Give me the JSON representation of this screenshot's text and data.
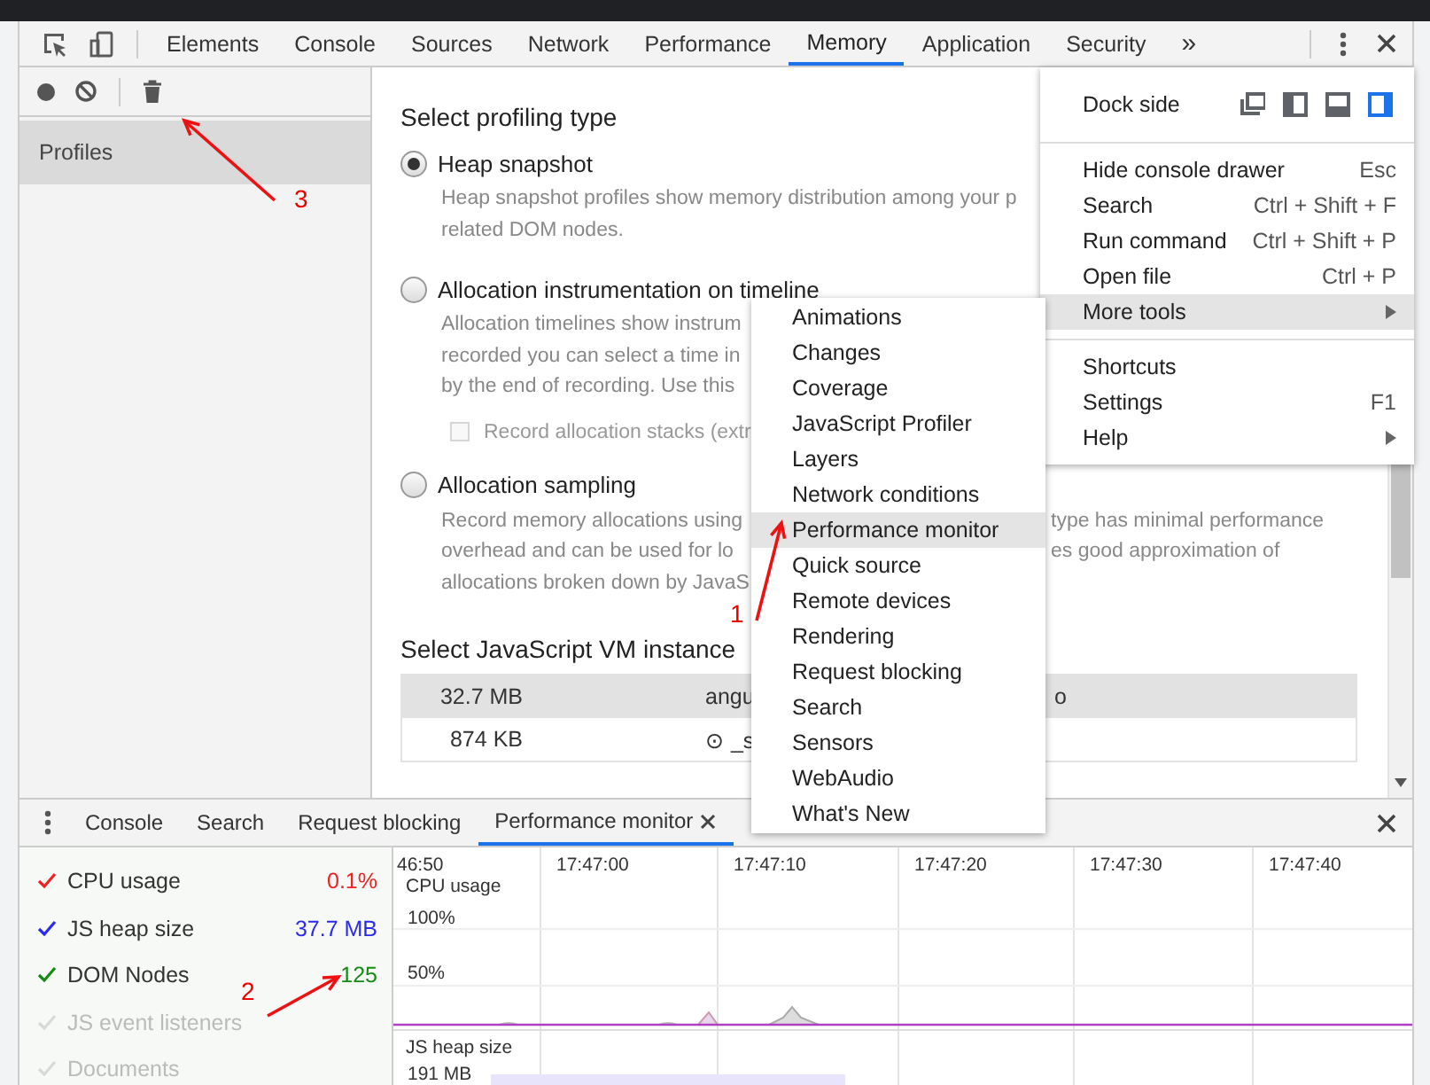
{
  "toolbar": {
    "tabs": [
      {
        "label": "Elements",
        "selected": false
      },
      {
        "label": "Console",
        "selected": false
      },
      {
        "label": "Sources",
        "selected": false
      },
      {
        "label": "Network",
        "selected": false
      },
      {
        "label": "Performance",
        "selected": false
      },
      {
        "label": "Memory",
        "selected": true
      },
      {
        "label": "Application",
        "selected": false
      },
      {
        "label": "Security",
        "selected": false
      }
    ],
    "overflow_label": "»"
  },
  "sidebar": {
    "items": [
      {
        "label": "Profiles",
        "selected": true
      }
    ]
  },
  "profiling": {
    "title": "Select profiling type",
    "options": [
      {
        "label": "Heap snapshot",
        "selected": true,
        "lines": [
          {
            "text": "Heap snapshot profiles show memory distribution among your p"
          },
          {
            "text": "related DOM nodes."
          }
        ]
      },
      {
        "label": "Allocation instrumentation on timeline",
        "selected": false,
        "lines": [
          {
            "text": "Allocation timelines show instrum"
          },
          {
            "text": "recorded you can select a time in"
          },
          {
            "text": "by the end of recording. Use this"
          }
        ],
        "checkbox": {
          "label": "Record allocation stacks (extr",
          "checked": false,
          "disabled": true
        }
      },
      {
        "label": "Allocation sampling",
        "selected": false,
        "lines": [
          {
            "text": "Record memory allocations using",
            "continuation": "type has minimal performance"
          },
          {
            "text": "overhead and can be used for lo",
            "continuation": "es good approximation of"
          },
          {
            "text": "allocations broken down by JavaS"
          }
        ]
      }
    ]
  },
  "vm_instance": {
    "title": "Select JavaScript VM instance",
    "rows": [
      {
        "size": "32.7 MB",
        "column_2": "angu",
        "column_3": "o",
        "selected": true
      },
      {
        "size": "874 KB",
        "column_2": "⊙ _s",
        "selected": false
      }
    ]
  },
  "main_menu": {
    "dock_side": {
      "label": "Dock side",
      "options": [
        {
          "kind": "undock",
          "selected": false
        },
        {
          "kind": "left",
          "selected": false
        },
        {
          "kind": "bottom",
          "selected": false
        },
        {
          "kind": "right",
          "selected": true
        }
      ]
    },
    "groups": [
      [
        {
          "label": "Hide console drawer",
          "shortcut": "Esc",
          "highlighted": false
        },
        {
          "label": "Search",
          "shortcut": "Ctrl + Shift + F",
          "highlighted": false
        },
        {
          "label": "Run command",
          "shortcut": "Ctrl + Shift + P",
          "highlighted": false
        },
        {
          "label": "Open file",
          "shortcut": "Ctrl + P",
          "highlighted": false
        },
        {
          "label": "More tools",
          "submenu": true,
          "highlighted": true
        }
      ],
      [
        {
          "label": "Shortcuts",
          "highlighted": false
        },
        {
          "label": "Settings",
          "shortcut": "F1",
          "highlighted": false
        },
        {
          "label": "Help",
          "submenu": true,
          "highlighted": false
        }
      ]
    ]
  },
  "submenu": {
    "items": [
      {
        "label": "Animations",
        "highlighted": false
      },
      {
        "label": "Changes",
        "highlighted": false
      },
      {
        "label": "Coverage",
        "highlighted": false
      },
      {
        "label": "JavaScript Profiler",
        "highlighted": false
      },
      {
        "label": "Layers",
        "highlighted": false
      },
      {
        "label": "Network conditions",
        "highlighted": false
      },
      {
        "label": "Performance monitor",
        "highlighted": true
      },
      {
        "label": "Quick source",
        "highlighted": false
      },
      {
        "label": "Remote devices",
        "highlighted": false
      },
      {
        "label": "Rendering",
        "highlighted": false
      },
      {
        "label": "Request blocking",
        "highlighted": false
      },
      {
        "label": "Search",
        "highlighted": false
      },
      {
        "label": "Sensors",
        "highlighted": false
      },
      {
        "label": "WebAudio",
        "highlighted": false
      },
      {
        "label": "What's New",
        "highlighted": false
      }
    ]
  },
  "drawer": {
    "tabs": [
      {
        "label": "Console",
        "selected": false
      },
      {
        "label": "Search",
        "selected": false
      },
      {
        "label": "Request blocking",
        "selected": false
      },
      {
        "label": "Performance monitor",
        "selected": true,
        "closable": true
      }
    ]
  },
  "performance_monitor": {
    "metrics": [
      {
        "label": "CPU usage",
        "value": "0.1%",
        "checked": true,
        "color": "#ee2222"
      },
      {
        "label": "JS heap size",
        "value": "37.7 MB",
        "checked": true,
        "color": "#2a2aee"
      },
      {
        "label": "DOM Nodes",
        "value": "125",
        "checked": true,
        "color": "#158a15"
      },
      {
        "label": "JS event listeners",
        "checked": false
      },
      {
        "label": "Documents",
        "checked": false
      }
    ],
    "time_labels": [
      "46:50",
      "17:47:00",
      "17:47:10",
      "17:47:20",
      "17:47:30",
      "17:47:40"
    ],
    "panels": [
      {
        "title": "CPU usage",
        "ticks": [
          "100%",
          "50%"
        ]
      },
      {
        "title": "JS heap size",
        "ticks": [
          "191 MB"
        ]
      }
    ]
  },
  "annotations": [
    {
      "text": "3"
    },
    {
      "text": "1"
    },
    {
      "text": "2"
    }
  ]
}
